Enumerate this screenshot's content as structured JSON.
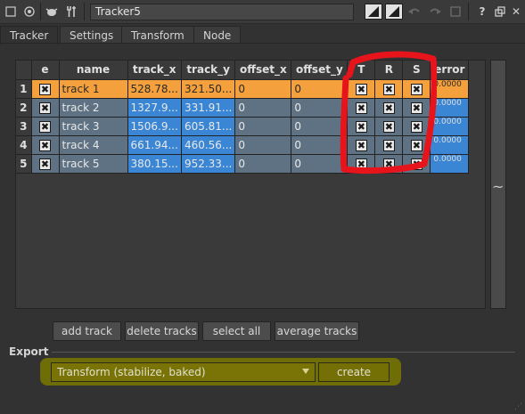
{
  "titlebar": {
    "node_name": "Tracker5",
    "icons": [
      "view-toggle-icon",
      "centre-icon",
      "bug-icon",
      "wrench-icon",
      "color-swatch-icon",
      "color-swatch-icon",
      "undo-icon",
      "redo-icon",
      "revert-icon",
      "help-icon",
      "float-icon",
      "close-icon"
    ],
    "help_label": "?",
    "close_label": "✕"
  },
  "tabs": [
    {
      "label": "Tracker"
    },
    {
      "label": "Settings"
    },
    {
      "label": "Transform"
    },
    {
      "label": "Node"
    }
  ],
  "table": {
    "headers": [
      "e",
      "name",
      "track_x",
      "track_y",
      "offset_x",
      "offset_y",
      "T",
      "R",
      "S",
      "error"
    ],
    "rows": [
      {
        "num": "1",
        "name": "track 1",
        "track_x": "528.78...",
        "track_y": "321.50...",
        "offset_x": "0",
        "offset_y": "0",
        "error": "0.0000"
      },
      {
        "num": "2",
        "name": "track 2",
        "track_x": "1327.9...",
        "track_y": "331.91...",
        "offset_x": "0",
        "offset_y": "0",
        "error": "0.0000"
      },
      {
        "num": "3",
        "name": "track 3",
        "track_x": "1506.9...",
        "track_y": "605.81...",
        "offset_x": "0",
        "offset_y": "0",
        "error": "0.0000"
      },
      {
        "num": "4",
        "name": "track 4",
        "track_x": "661.94...",
        "track_y": "460.56...",
        "offset_x": "0",
        "offset_y": "0",
        "error": "0.0000"
      },
      {
        "num": "5",
        "name": "track 5",
        "track_x": "380.15...",
        "track_y": "952.33...",
        "offset_x": "0",
        "offset_y": "0",
        "error": "0.0000"
      }
    ],
    "checkbox_glyph": "✖"
  },
  "buttons": {
    "add_track": "add track",
    "delete_tracks": "delete tracks",
    "select_all": "select all",
    "average_tracks": "average tracks"
  },
  "export": {
    "label": "Export",
    "select_value": "Transform (stabilize, baked)",
    "create_label": "create"
  },
  "colors": {
    "selected_row": "#f4a03c",
    "track_cell": "#3a86d4",
    "annotation": "#e8141c",
    "export_highlight": "#6f6d06"
  }
}
